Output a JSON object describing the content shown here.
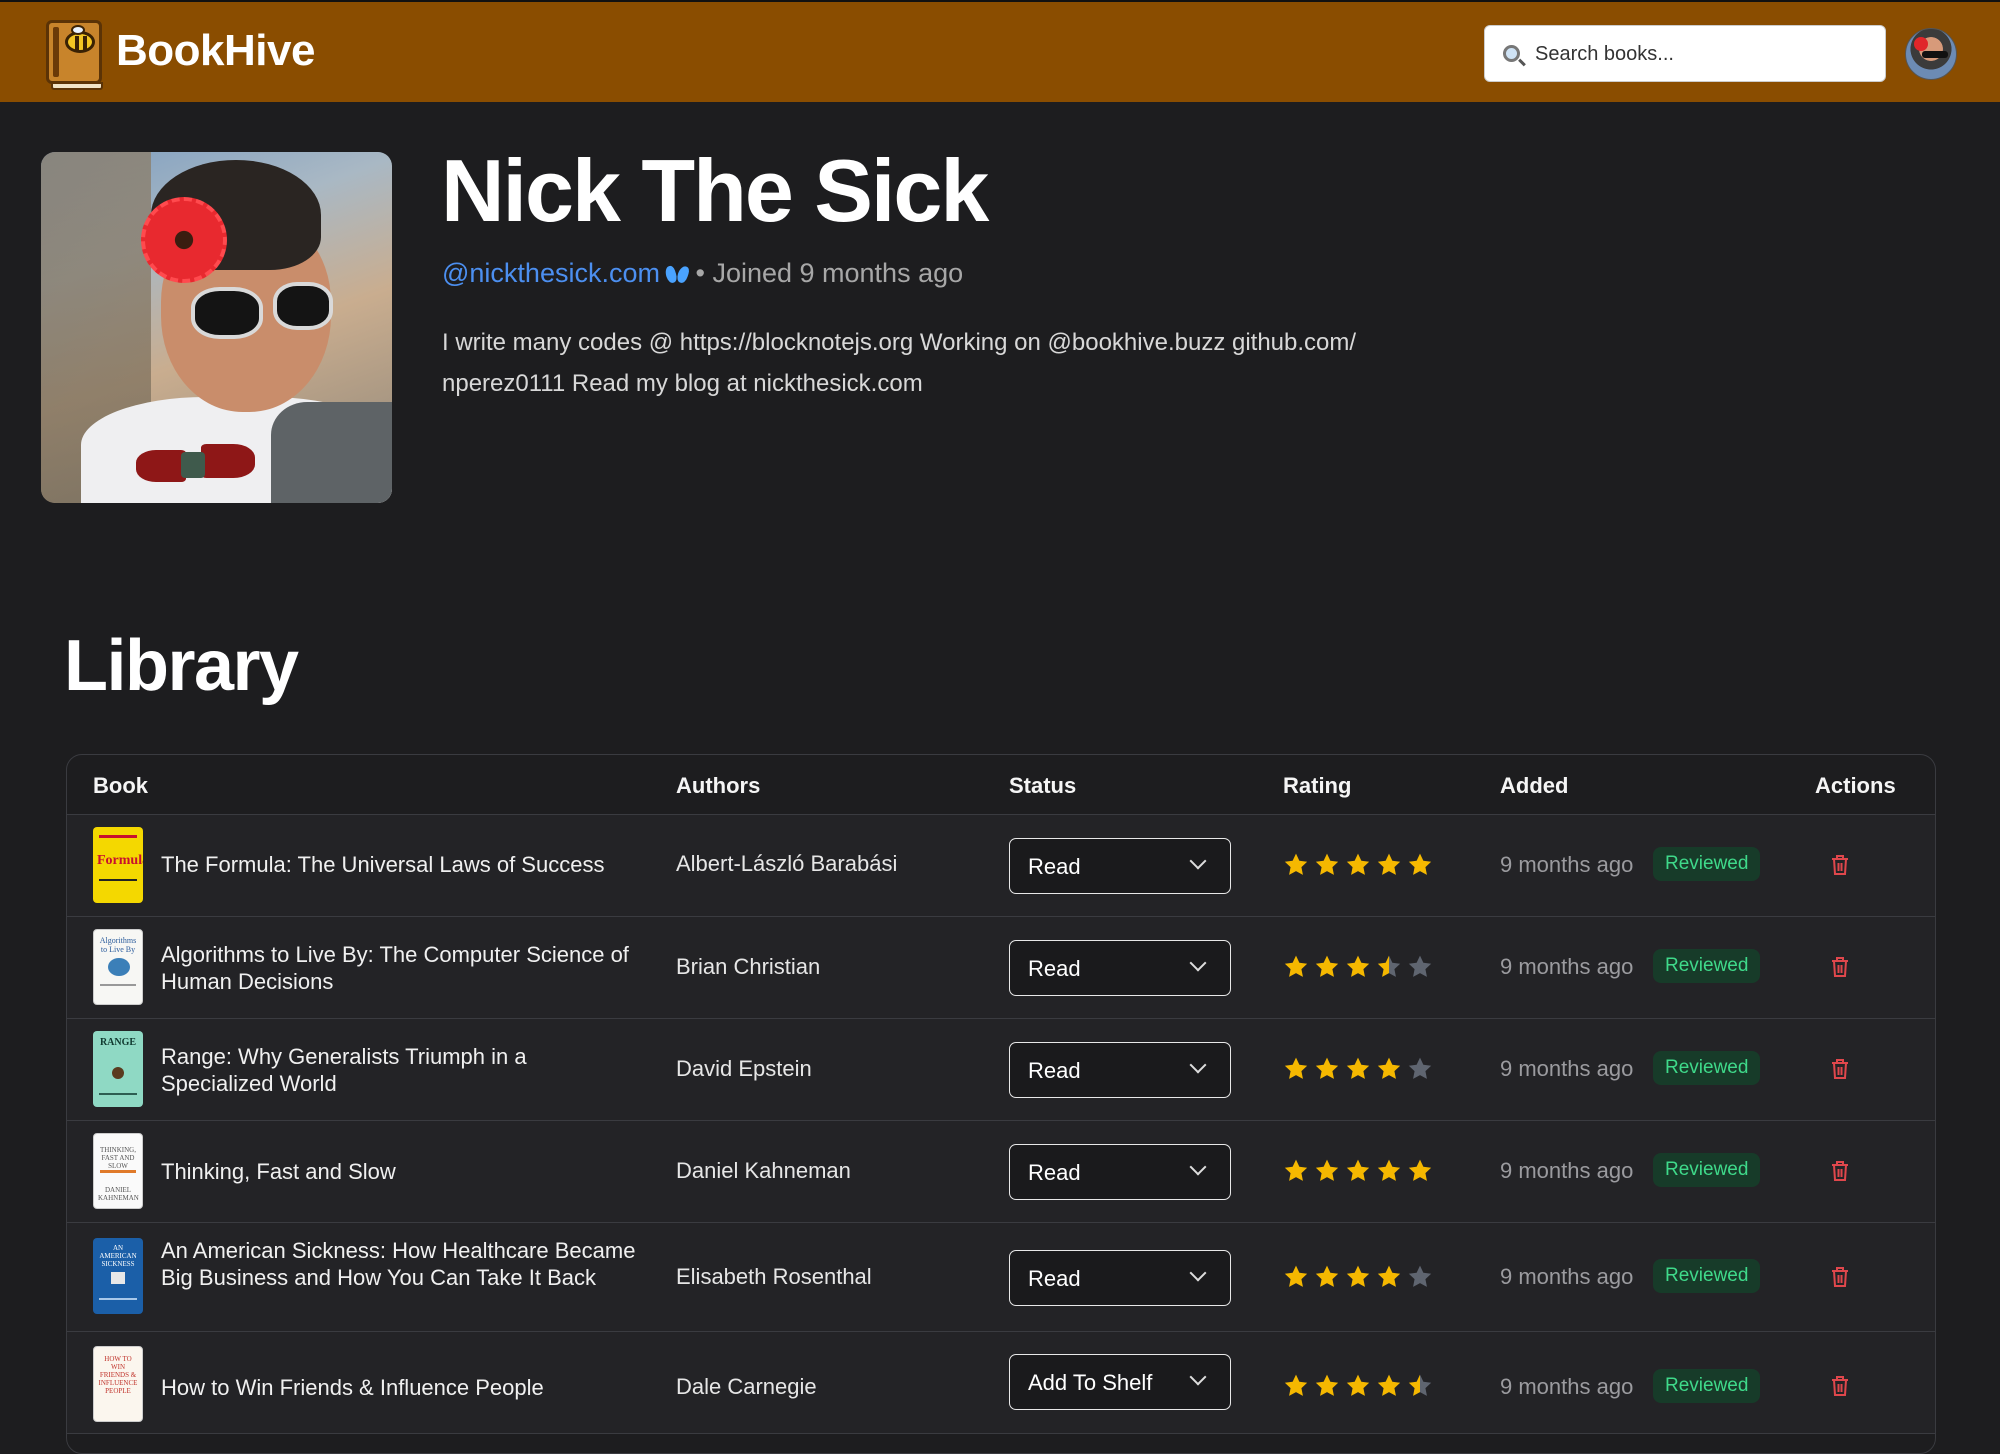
{
  "header": {
    "brand": "BookHive",
    "search_placeholder": "Search books..."
  },
  "profile": {
    "name": "Nick The Sick",
    "handle": "@nickthesick.com",
    "separator": "•",
    "joined": "Joined 9 months ago",
    "bio": "I write many codes @ https://blocknotejs.org Working on @bookhive.buzz github.com/ nperez0111 Read my blog at nickthesick.com"
  },
  "library": {
    "title": "Library",
    "columns": [
      "Book",
      "Authors",
      "Status",
      "Rating",
      "Added",
      "Actions"
    ],
    "rows": [
      {
        "title": "The Formula: The Universal Laws of Success",
        "author": "Albert-László Barabási",
        "status": "Read",
        "rating": 5,
        "added": "9 months ago",
        "badge": "Reviewed"
      },
      {
        "title": "Algorithms to Live By: The Computer Science of Human Decisions",
        "author": "Brian Christian",
        "status": "Read",
        "rating": 3.5,
        "added": "9 months ago",
        "badge": "Reviewed"
      },
      {
        "title": "Range: Why Generalists Triumph in a Specialized World",
        "author": "David Epstein",
        "status": "Read",
        "rating": 4,
        "added": "9 months ago",
        "badge": "Reviewed"
      },
      {
        "title": "Thinking, Fast and Slow",
        "author": "Daniel Kahneman",
        "status": "Read",
        "rating": 5,
        "added": "9 months ago",
        "badge": "Reviewed"
      },
      {
        "title": "An American Sickness: How Healthcare Became Big Business and How You Can Take It Back",
        "author": "Elisabeth Rosenthal",
        "status": "Read",
        "rating": 4,
        "added": "9 months ago",
        "badge": "Reviewed"
      },
      {
        "title": "How to Win Friends & Influence People",
        "author": "Dale Carnegie",
        "status": "Add To Shelf",
        "rating": 4.5,
        "added": "9 months ago",
        "badge": "Reviewed"
      }
    ]
  },
  "colors": {
    "header_bg": "#8a4d00",
    "page_bg": "#1d1d1f",
    "row_bg": "#232326",
    "star_filled": "#f5b800",
    "star_empty": "#5f6570",
    "link": "#4c8ff0",
    "badge_bg": "#173b29",
    "badge_text": "#3fd98a",
    "delete": "#e0474c"
  },
  "icons": {
    "logo": "bee-book-icon",
    "search": "magnifier-icon",
    "handle_badge": "butterfly-icon",
    "status_dropdown": "chevron-down-icon",
    "rating": "star-icon",
    "delete": "trash-icon"
  }
}
